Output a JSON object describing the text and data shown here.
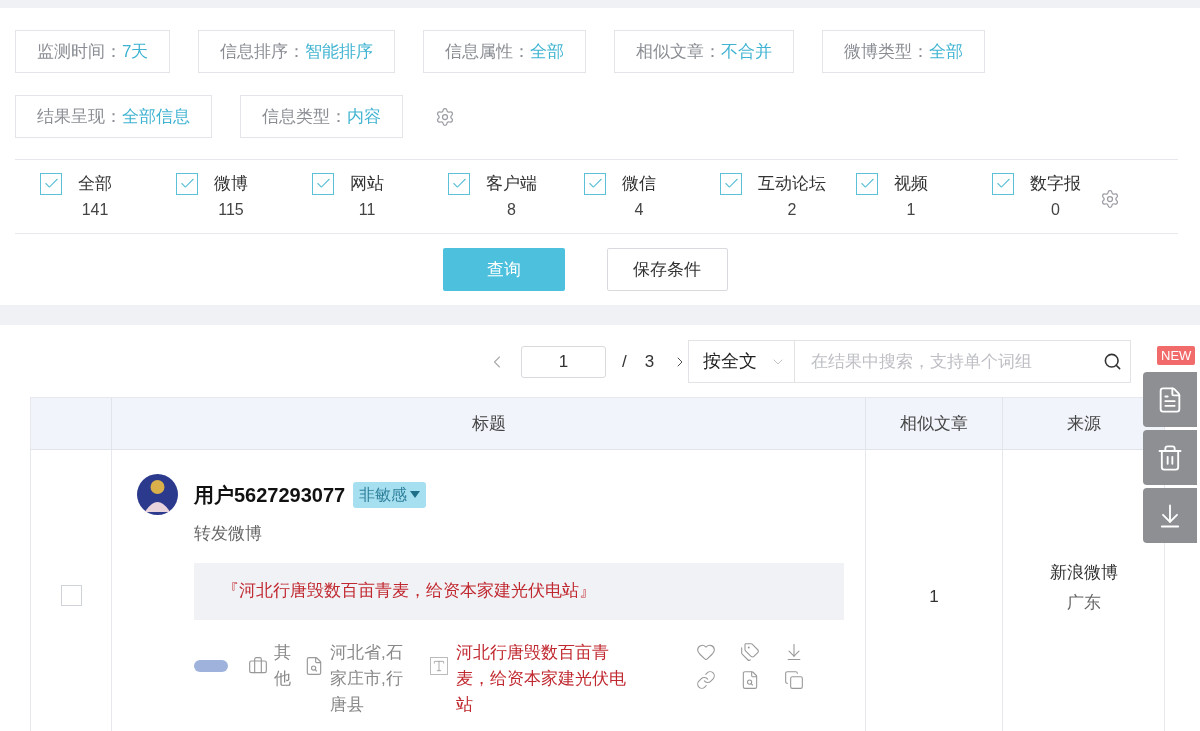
{
  "filters": [
    {
      "label": "监测时间：",
      "value": "7天"
    },
    {
      "label": "信息排序：",
      "value": "智能排序"
    },
    {
      "label": "信息属性：",
      "value": "全部"
    },
    {
      "label": "相似文章：",
      "value": "不合并"
    },
    {
      "label": "微博类型：",
      "value": "全部"
    },
    {
      "label": "结果呈现：",
      "value": "全部信息"
    },
    {
      "label": "信息类型：",
      "value": "内容"
    }
  ],
  "channels": [
    {
      "label": "全部",
      "count": "141",
      "checked": true
    },
    {
      "label": "微博",
      "count": "115",
      "checked": true
    },
    {
      "label": "网站",
      "count": "11",
      "checked": true
    },
    {
      "label": "客户端",
      "count": "8",
      "checked": true
    },
    {
      "label": "微信",
      "count": "4",
      "checked": true
    },
    {
      "label": "互动论坛",
      "count": "2",
      "checked": true
    },
    {
      "label": "视频",
      "count": "1",
      "checked": true
    },
    {
      "label": "数字报",
      "count": "0",
      "checked": true
    }
  ],
  "buttons": {
    "query": "查询",
    "save": "保存条件"
  },
  "pagination": {
    "current": "1",
    "separator": "/",
    "total": "3"
  },
  "search": {
    "mode": "按全文",
    "placeholder": "在结果中搜索，支持单个词组"
  },
  "new_badge": "NEW",
  "table": {
    "columns": [
      "标题",
      "相似文章",
      "来源"
    ],
    "rows": [
      {
        "selected": false,
        "user": "用户5627293077",
        "sentiment": "非敏感",
        "action": "转发微博",
        "quote": "『河北行唐毁数百亩青麦，给资本家建光伏电站』",
        "category": "其他",
        "location": "河北省,石家庄市,行唐县",
        "headline": "河北行唐毁数百亩青麦，给资本家建光伏电站",
        "similar": "1",
        "source": "新浪微博",
        "region": "广东"
      }
    ]
  }
}
